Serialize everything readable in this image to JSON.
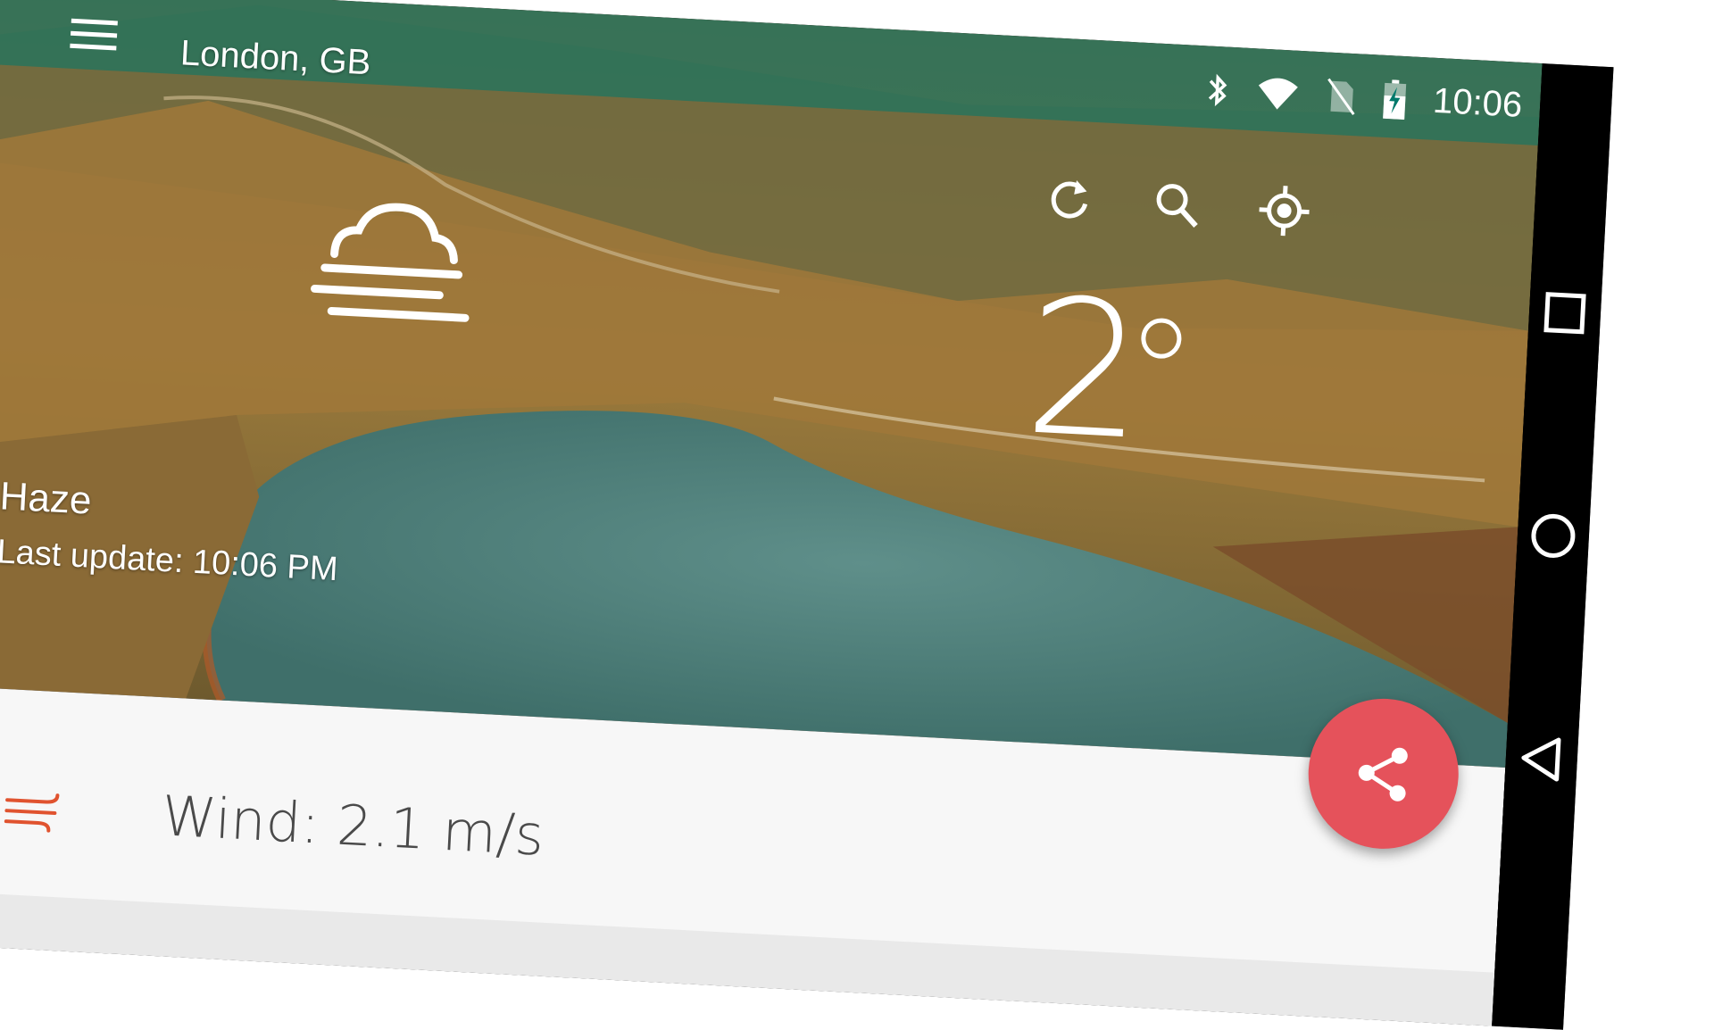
{
  "status_bar": {
    "time": "10:06",
    "icons": [
      "bluetooth-icon",
      "wifi-icon",
      "no-sim-icon",
      "battery-charging-icon"
    ],
    "color": "#00796b"
  },
  "toolbar": {
    "title": "London, GB",
    "menu_icon": "menu-icon",
    "actions": [
      "refresh-icon",
      "search-icon",
      "my-location-icon"
    ]
  },
  "weather": {
    "icon": "haze-icon",
    "temperature": "2",
    "condition": "Haze",
    "last_update": "Last update: 10:06 PM"
  },
  "details": {
    "wind": {
      "icon": "wind-icon",
      "text": "Wind: 2.1 m/s",
      "icon_color": "#e0532f"
    }
  },
  "fab": {
    "icon": "share-icon",
    "color": "#e5525b"
  },
  "nav_bar": [
    "recent-apps-icon",
    "home-icon",
    "back-icon"
  ]
}
